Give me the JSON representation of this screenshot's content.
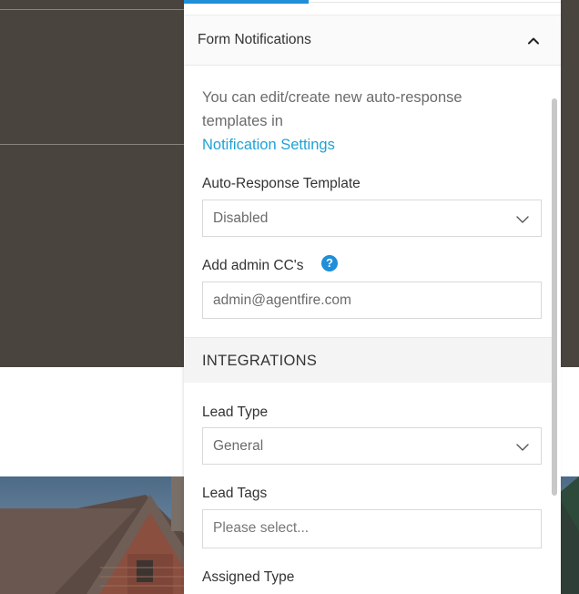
{
  "panel": {
    "section_title": "Form Notifications",
    "info_text": "You can edit/create new auto-response templates in",
    "info_link": "Notification Settings",
    "auto_response": {
      "label": "Auto-Response Template",
      "value": "Disabled"
    },
    "admin_cc": {
      "label": "Add admin CC's",
      "help": "?",
      "value": "admin@agentfire.com"
    },
    "integrations_title": "INTEGRATIONS",
    "lead_type": {
      "label": "Lead Type",
      "value": "General"
    },
    "lead_tags": {
      "label": "Lead Tags",
      "placeholder": "Please select..."
    },
    "assigned_type": {
      "label": "Assigned Type"
    }
  },
  "colors": {
    "accent": "#1e8fd8",
    "link": "#1ea2d6",
    "background_dark": "#4a443e"
  },
  "icons": {
    "collapse": "chevron-up-icon",
    "dropdown": "chevron-down-icon",
    "help": "help-circle-icon"
  }
}
